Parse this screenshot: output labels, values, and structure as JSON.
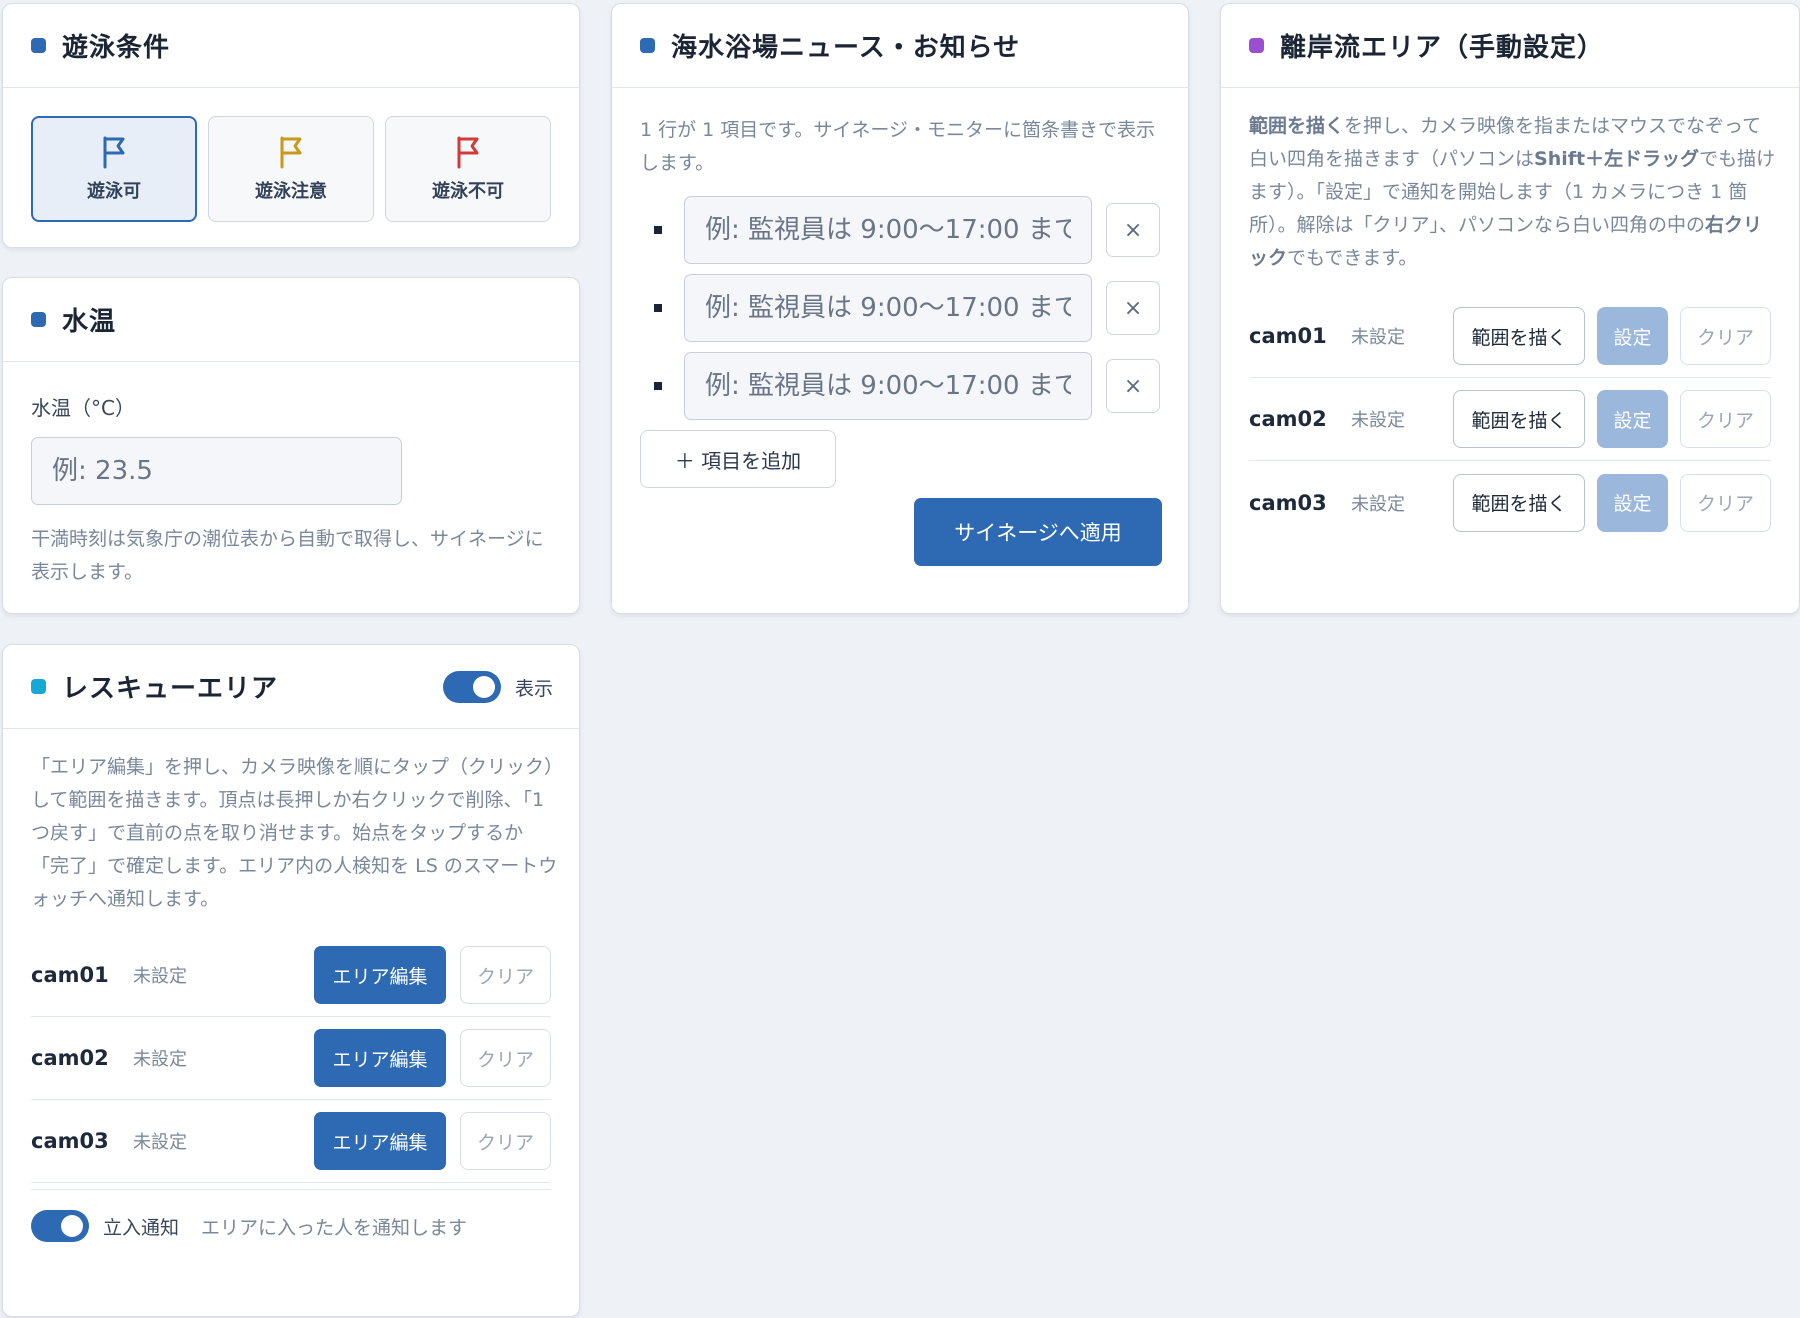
{
  "colors": {
    "primary": "#2e6ab3",
    "dot_blue": "#2e6ab3",
    "dot_cyan": "#17a9d6",
    "dot_purple": "#9b4fd0",
    "flag_ok": "#2e6ab3",
    "flag_caution": "#c99a1a",
    "flag_ng": "#d23a3a"
  },
  "swim": {
    "title": "遊泳条件",
    "options": [
      {
        "label": "遊泳可",
        "icon": "flag-icon",
        "active": true
      },
      {
        "label": "遊泳注意",
        "icon": "flag-icon",
        "active": false
      },
      {
        "label": "遊泳不可",
        "icon": "flag-icon",
        "active": false
      }
    ]
  },
  "water": {
    "title": "水温",
    "label": "水温（°C）",
    "placeholder": "例: 23.5",
    "help": "干満時刻は気象庁の潮位表から自動で取得し、サイネージに表示します。"
  },
  "news": {
    "title": "海水浴場ニュース・お知らせ",
    "description": "1 行が 1 項目です。サイネージ・モニターに箇条書きで表示します。",
    "items": [
      {
        "placeholder": "例: 監視員は 9:00〜17:00 まで"
      },
      {
        "placeholder": "例: 監視員は 9:00〜17:00 まで"
      },
      {
        "placeholder": "例: 監視員は 9:00〜17:00 まで"
      }
    ],
    "remove_label": "×",
    "add_label": "＋ 項目を追加",
    "apply_label": "サイネージへ適用"
  },
  "rip": {
    "title": "離岸流エリア（手動設定）",
    "help_parts": {
      "p1": "範囲を描く",
      "p2": "を押し、カメラ映像を指またはマウスでなぞって白い四角を描きます（パソコンは",
      "p3": "Shift＋左ドラッグ",
      "p4": "でも描けます）。「設定」で通知を開始します（1 カメラにつき 1 箇所）。解除は「クリア」、パソコンなら白い四角の中の",
      "p5": "右クリック",
      "p6": "でもできます。"
    },
    "draw_label": "範囲を描く",
    "set_label": "設定",
    "clear_label": "クリア",
    "cams": [
      {
        "name": "cam01",
        "status": "未設定"
      },
      {
        "name": "cam02",
        "status": "未設定"
      },
      {
        "name": "cam03",
        "status": "未設定"
      }
    ]
  },
  "rescue": {
    "title": "レスキューエリア",
    "toggle_label": "表示",
    "help": "「エリア編集」を押し、カメラ映像を順にタップ（クリック）して範囲を描きます。頂点は長押しか右クリックで削除、「1つ戻す」で直前の点を取り消せます。始点をタップするか「完了」で確定します。エリア内の人検知を LS のスマートウォッチへ通知します。",
    "edit_label": "エリア編集",
    "clear_label": "クリア",
    "cams": [
      {
        "name": "cam01",
        "status": "未設定"
      },
      {
        "name": "cam02",
        "status": "未設定"
      },
      {
        "name": "cam03",
        "status": "未設定"
      }
    ],
    "entry_label": "立入通知",
    "entry_desc": "エリアに入った人を通知します"
  }
}
